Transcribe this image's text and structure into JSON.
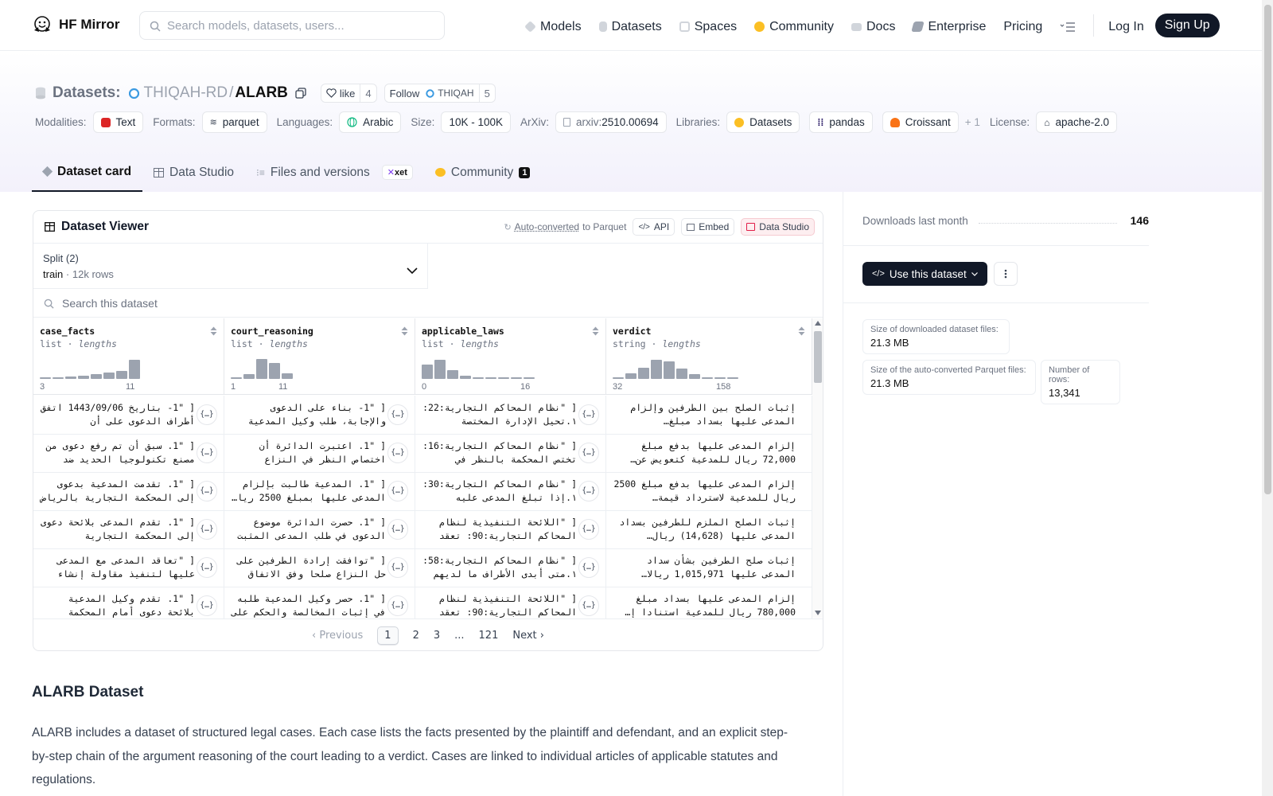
{
  "nav": {
    "brand": "HF Mirror",
    "search_placeholder": "Search models, datasets, users...",
    "links": [
      "Models",
      "Datasets",
      "Spaces",
      "Community",
      "Docs",
      "Enterprise",
      "Pricing"
    ],
    "login": "Log In",
    "signup": "Sign Up"
  },
  "header": {
    "section": "Datasets:",
    "org": "THIQAH-RD",
    "slash": "/",
    "name": "ALARB",
    "like_label": "like",
    "like_count": "4",
    "follow_label": "Follow",
    "follow_org": "THIQAH",
    "follow_count": "5"
  },
  "meta": {
    "modalities_label": "Modalities:",
    "modality": "Text",
    "formats_label": "Formats:",
    "format": "parquet",
    "languages_label": "Languages:",
    "language": "Arabic",
    "size_label": "Size:",
    "size": "10K - 100K",
    "arxiv_label": "ArXiv:",
    "arxiv_prefix": "arxiv:",
    "arxiv_id": "2510.00694",
    "libraries_label": "Libraries:",
    "libraries": [
      "Datasets",
      "pandas",
      "Croissant"
    ],
    "libraries_more": "+ 1",
    "license_label": "License:",
    "license": "apache-2.0"
  },
  "tabs": {
    "card": "Dataset card",
    "studio": "Data Studio",
    "files": "Files and versions",
    "xet": "xet",
    "community": "Community",
    "community_count": "1"
  },
  "viewer": {
    "title": "Dataset Viewer",
    "auto_converted": "Auto-converted",
    "to_parquet": "to Parquet",
    "api": "API",
    "embed": "Embed",
    "studio": "Data Studio",
    "split_label": "Split (2)",
    "split_name": "train",
    "split_sep": "·",
    "split_rows": "12k rows",
    "search_placeholder": "Search this dataset",
    "columns": [
      {
        "name": "case_facts",
        "type": "list",
        "sub": "lengths",
        "min": "3",
        "max": "11",
        "hist": [
          0.05,
          0.05,
          0.1,
          0.15,
          0.22,
          0.3,
          0.35,
          0.85
        ]
      },
      {
        "name": "court_reasoning",
        "type": "list",
        "sub": "lengths",
        "min": "1",
        "max": "11",
        "hist": [
          0.05,
          0.2,
          0.9,
          0.7,
          0.25
        ]
      },
      {
        "name": "applicable_laws",
        "type": "list",
        "sub": "lengths",
        "min": "0",
        "max": "16",
        "hist": [
          0.65,
          0.85,
          0.4,
          0.15,
          0.05,
          0.05,
          0.05,
          0.05,
          0.05
        ]
      },
      {
        "name": "verdict",
        "type": "string",
        "sub": "lengths",
        "min": "32",
        "max": "158",
        "hist": [
          0.05,
          0.25,
          0.5,
          0.85,
          0.8,
          0.45,
          0.2,
          0.08,
          0.05,
          0.05
        ]
      }
    ],
    "rows": [
      {
        "case_facts": "[ \"1- بتاريخ 1443/09/06 اتفق أطراف الدعوى على أن",
        "court_reasoning": "[ \"1- بناء على الدعوى والإجابة، طلب وكيل المدعية",
        "applicable_laws": "[ \"نظام المحاكم التجارية:22: ١.تحيل الإدارة المختصة",
        "verdict": "إثبات الصلح بين الطرفين وإلزام المدعى عليها بسداد مبلغ…"
      },
      {
        "case_facts": "[ \"1. سبق أن تم رفع دعوى من مصنع تكنولوجيا الحديد ضد",
        "court_reasoning": "[ \"1. اعتبرت الدائرة أن اختصاص النظر في النزاع",
        "applicable_laws": "[ \"نظام المحاكم التجارية:16: تختص المحكمة بالنظر في",
        "verdict": "إلزام المدعى عليها بدفع مبلغ 72,000 ريال للمدعية كتعويض عن…"
      },
      {
        "case_facts": "[ \"1. تقدمت المدعية بدعوى إلى المحكمة التجارية بالرياض",
        "court_reasoning": "[ \"1. المدعية طالبت بإلزام المدعى عليها بمبلغ 2500 ريا…",
        "applicable_laws": "[ \"نظام المحاكم التجارية:30: ١.إذا تبلغ المدعى عليه",
        "verdict": "إلزام المدعى عليها بدفع مبلغ 2500 ريال للمدعية لاسترداد قيمة…"
      },
      {
        "case_facts": "[ \"1. تقدم المدعى بلائحة دعوى إلى المحكمة التجارية",
        "court_reasoning": "[ \"1. حصرت الدائرة موضوع الدعوى في طلب المدعى المثبت …",
        "applicable_laws": "[ \"اللائحة التنفيذية لنظام المحاكم التجارية:90: تعقد",
        "verdict": "إثبات الصلح الملزم للطرفين بسداد المدعى عليها (14,628) ريال…"
      },
      {
        "case_facts": "[ \"تعاقد المدعى مع المدعى عليها لتنفيذ مقاولة إنشاء",
        "court_reasoning": "[ \"توافقت إرادة الطرفين على حل النزاع صلحا وفق الاتفاق",
        "applicable_laws": "[ \"نظام المحاكم التجارية:58: ١.متى أبدى الأطراف ما لديهم",
        "verdict": "إثبات صلح الطرفين بشأن سداد المدعى عليها 1,015,971 ريالا…"
      },
      {
        "case_facts": "[ \"1. تقدم وكيل المدعية بلائحة دعوى أمام المحكمة",
        "court_reasoning": "[ \"1. حصر وكيل المدعية طلبه في إثبات المخالصة والحكم على",
        "applicable_laws": "[ \"اللائحة التنفيذية لنظام المحاكم التجارية:90: تعقد",
        "verdict": "إلزام المدعى عليها بسداد مبلغ 780,000 ريال للمدعية استنادا إ…"
      }
    ],
    "json_glyph": "{…}",
    "pager": {
      "prev": "Previous",
      "pages": [
        "1",
        "2",
        "3",
        "...",
        "121"
      ],
      "next": "Next"
    }
  },
  "sidebar": {
    "downloads_label": "Downloads last month",
    "downloads": "146",
    "use_button": "Use this dataset",
    "stats": [
      {
        "label": "Size of downloaded dataset files:",
        "value": "21.3 MB"
      },
      {
        "label": "Size of the auto-converted Parquet files:",
        "value": "21.3 MB"
      },
      {
        "label": "Number of rows:",
        "value": "13,341"
      }
    ]
  },
  "about": {
    "heading": "ALARB Dataset",
    "text": "ALARB includes a dataset of structured legal cases. Each case lists the facts presented by the plaintiff and defendant, and an explicit step-by-step chain of the argument reasoning of the court leading to a verdict. Cases are linked to individual articles of applicable statutes and regulations."
  },
  "colors": {
    "accent": "#111827",
    "hist_bar": "#9ca3af",
    "studio_red": "#e11d48",
    "hf_yellow": "#fbbf24"
  }
}
